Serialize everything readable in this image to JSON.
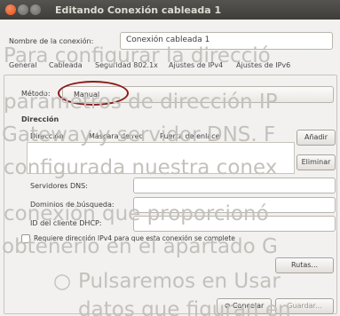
{
  "window": {
    "title": "Editando Conexión cableada 1"
  },
  "connection": {
    "name_label": "Nombre de la conexión:",
    "name_value": "Conexión cableada 1"
  },
  "tabs": [
    {
      "label": "General"
    },
    {
      "label": "Cableada"
    },
    {
      "label": "Seguridad 802.1x"
    },
    {
      "label": "Ajustes de IPv4"
    },
    {
      "label": "Ajustes de IPv6"
    }
  ],
  "ipv4": {
    "method_label": "Método:",
    "method_value": "Manual",
    "address_heading": "Dirección",
    "columns": [
      "Dirección",
      "Máscara de red",
      "Puerta de enlace"
    ],
    "add_button": "Añadir",
    "remove_button": "Eliminar",
    "dns_label": "Servidores DNS:",
    "search_domains_label": "Dominios de búsqueda:",
    "dhcp_id_label": "ID del cliente DHCP:",
    "require_ipv4_label": "Requiere dirección IPv4 para que esta conexión se complete",
    "routes_button": "Rutas...",
    "cancel_button": "Cancelar",
    "save_button": "Guardar..."
  },
  "overlay": {
    "line1": "Para configurar la direcció",
    "line2": "parámetros de dirección IP",
    "line3": "Gateway y servidor DNS. F",
    "line4": "configurada nuestra conex",
    "line5": "conexión que proporcionó",
    "line6": "obtenerlo en el apartado G",
    "line7_bullet": "○",
    "line7": "Pulsaremos en Usar",
    "line8": "datos que figuran en"
  }
}
